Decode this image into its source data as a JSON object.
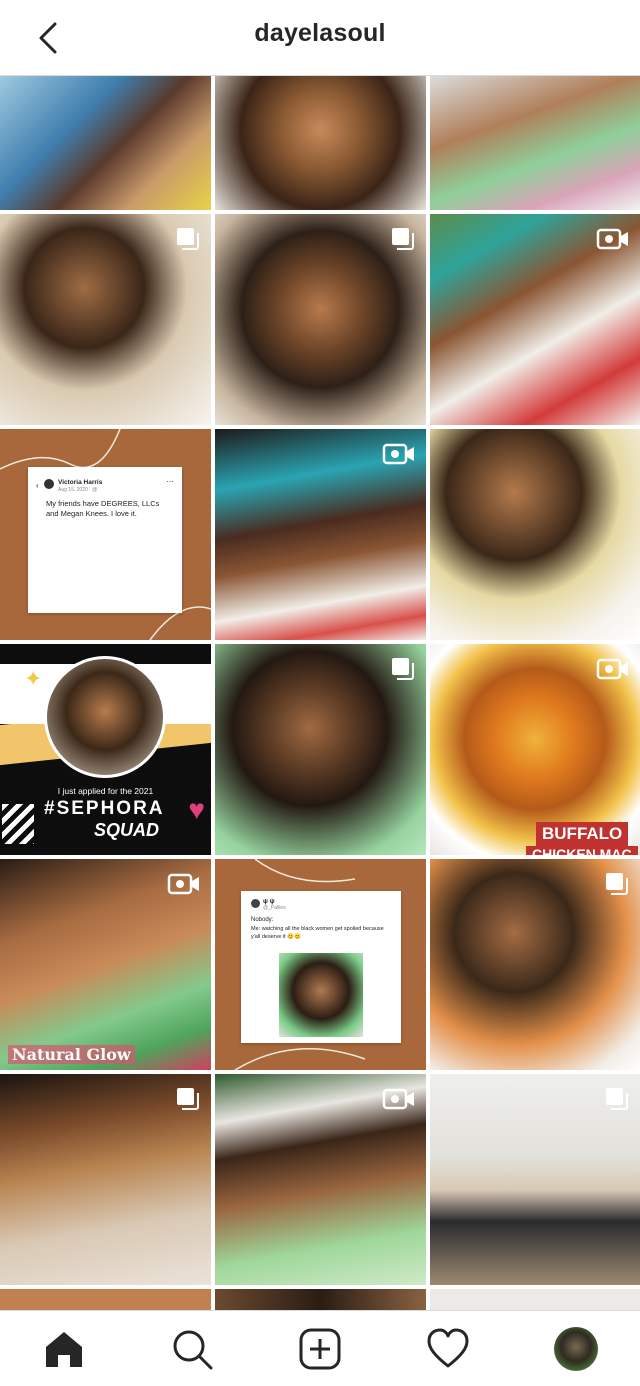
{
  "header": {
    "title": "dayelasoul"
  },
  "posts": {
    "p10": {
      "name": "Victoria Harris",
      "date": "Aug 15, 2020 · @",
      "text": "My friends have DEGREES, LLCs and Megan Knees. I love it."
    },
    "p13": {
      "line1": "I just applied for the 2021",
      "line2": "#SEPHORA",
      "line3": "SQUAD"
    },
    "p15": {
      "caption1": "BUFFALO",
      "caption2": "CHICKEN MAC"
    },
    "p16": {
      "caption": "Natural Glow"
    },
    "p17": {
      "name": "ψ ψ",
      "date": "@_Pallies",
      "label": "Nobody:",
      "text": "Me: watching all the black women get spoiled because y'all deserve it 😊😊"
    }
  },
  "icons": {
    "back": "chevron-left-icon",
    "multi": "carousel-icon",
    "video": "video-camera-icon",
    "home": "home-icon",
    "search": "search-icon",
    "create": "add-post-icon",
    "activity": "heart-icon",
    "profile": "profile-avatar"
  },
  "colors": {
    "accent": "#262626",
    "border": "#dbdbdb",
    "brown": "#a8683c"
  }
}
